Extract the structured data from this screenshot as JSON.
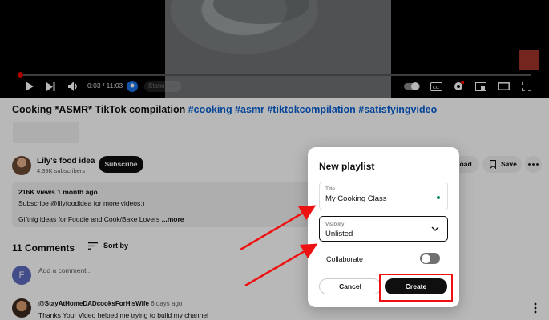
{
  "player": {
    "time": "0:03 / 11:03",
    "ambient": "Stationary",
    "progress_fraction": 0.005,
    "badge_color": "#a1342a"
  },
  "video": {
    "title_text": "Cooking *ASMR* TikTok compilation ",
    "hashtags": "#cooking #asmr #tiktokcompilation #satisfyingvideo"
  },
  "channel": {
    "name": "Lily's food idea",
    "subscribers": "4.39K subscribers",
    "subscribe_label": "Subscribe"
  },
  "actions": {
    "download_label": "nload",
    "save_label": "Save"
  },
  "description": {
    "meta": "216K views  1 month ago",
    "line1": "Subscribe  @lilyfoodidea  for more videos;)",
    "line2": "Giftnig ideas for Foodie and Cook/Bake Lovers ",
    "more": "...more"
  },
  "comments": {
    "count": "11 Comments",
    "sort_label": "Sort by",
    "my_avatar_letter": "F",
    "placeholder": "Add a comment...",
    "items": [
      {
        "author": "@StayAtHomeDADcooksForHisWife",
        "time": "6 days ago",
        "text": "Thanks Your Video helped me trying to build my channel"
      }
    ]
  },
  "modal": {
    "title": "New playlist",
    "title_field_label": "Title",
    "title_field_value": "My Cooking Class",
    "visibility_label": "Visibility",
    "visibility_value": "Unlisted",
    "collaborate_label": "Collaborate",
    "collaborate_on": false,
    "cancel_label": "Cancel",
    "create_label": "Create"
  },
  "colors": {
    "annotation_red": "#e11111",
    "link_blue": "#065fd4",
    "progress_red": "#ee0000"
  }
}
